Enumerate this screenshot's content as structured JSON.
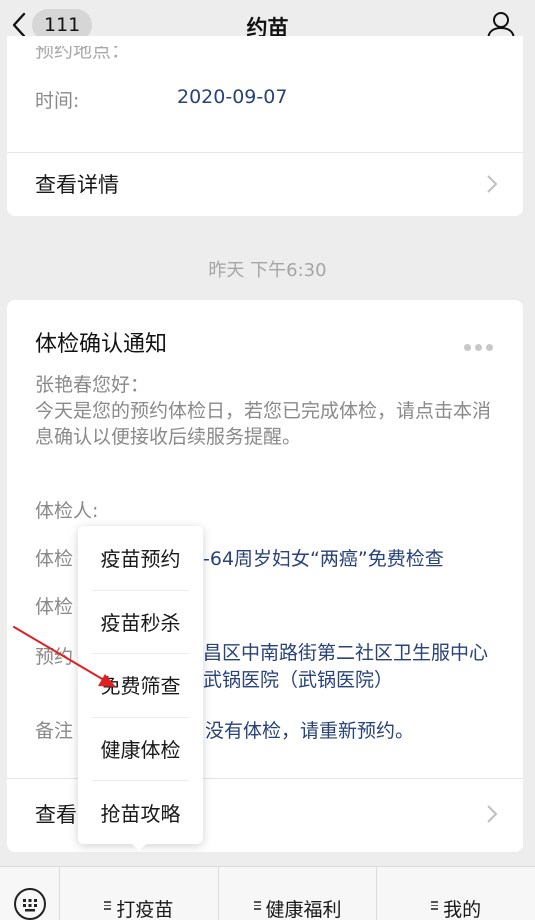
{
  "nav": {
    "badge": "111",
    "title": "约苗"
  },
  "card1": {
    "clipped_text": "预约地点：",
    "time_label": "时间:",
    "time_value": "2020-09-07",
    "detail_label": "查看详情"
  },
  "timestamp": "昨天 下午6:30",
  "card2": {
    "title": "体检确认通知",
    "greeting": "张艳春您好：",
    "message": "今天是您的预约体检日，若您已完成体检，请点击本消息确认以便接收后续服务提醒。",
    "rows": [
      {
        "label": "体检人:",
        "value": ""
      },
      {
        "label": "体检",
        "value": "-64周岁妇女“两癌”免费检查"
      },
      {
        "label": "体检",
        "value": ""
      },
      {
        "label": "预约",
        "value": "昌区中南路街第二社区卫生服中心武锅医院（武锅医院）"
      },
      {
        "label": "备注",
        "value": "没有体检，请重新预约。"
      }
    ],
    "detail_label": "查看"
  },
  "popup": {
    "items": [
      "疫苗预约",
      "疫苗秒杀",
      "免费筛查",
      "健康体检",
      "抢苗攻略"
    ]
  },
  "bottom_menu": {
    "items": [
      "打疫苗",
      "健康福利",
      "我的"
    ]
  },
  "colors": {
    "link_blue": "#28427a",
    "annotation_arrow": "#e02020"
  }
}
